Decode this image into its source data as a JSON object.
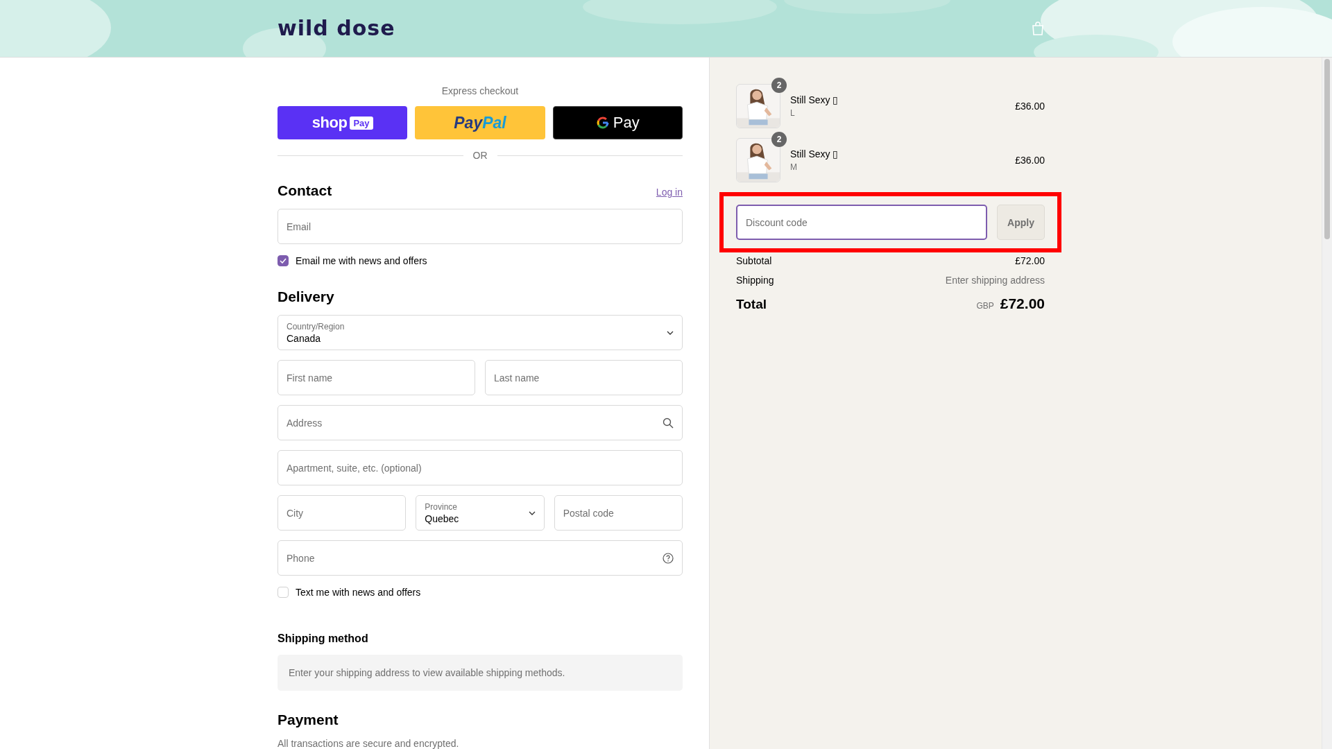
{
  "header": {
    "logo": "wild dose"
  },
  "express_checkout": {
    "title": "Express checkout",
    "buttons": [
      {
        "kind": "shop_pay",
        "text": "shop",
        "badge": "Pay"
      },
      {
        "kind": "paypal",
        "text": "Pay",
        "text2": "Pal"
      },
      {
        "kind": "google_pay",
        "text": "Pay"
      }
    ],
    "divider": "OR"
  },
  "contact": {
    "heading": "Contact",
    "link": "Log in",
    "email_placeholder": "Email",
    "newsletter": {
      "label": "Email me with news and offers",
      "checked": true
    }
  },
  "delivery": {
    "heading": "Delivery",
    "rows": [
      [
        {
          "kind": "select",
          "label": "Country/Region",
          "value": "Canada"
        }
      ],
      [
        {
          "kind": "input",
          "placeholder": "First name"
        },
        {
          "kind": "input",
          "placeholder": "Last name"
        }
      ],
      [
        {
          "kind": "search_input",
          "placeholder": "Address"
        }
      ],
      [
        {
          "kind": "input",
          "placeholder": "Apartment, suite, etc. (optional)"
        }
      ],
      [
        {
          "kind": "input",
          "placeholder": "City"
        },
        {
          "kind": "select",
          "label": "Province",
          "value": "Quebec"
        },
        {
          "kind": "input",
          "placeholder": "Postal code"
        }
      ],
      [
        {
          "kind": "help_input",
          "placeholder": "Phone"
        }
      ]
    ],
    "sms": {
      "label": "Text me with news and offers",
      "checked": false
    }
  },
  "shipping_method": {
    "heading": "Shipping method",
    "notice": "Enter your shipping address to view available shipping methods."
  },
  "payment": {
    "heading": "Payment",
    "note": "All transactions are secure and encrypted."
  },
  "summary": {
    "items": [
      {
        "quantity": "2",
        "title": "Still Sexy ▯",
        "variant": "L",
        "price": "£36.00"
      },
      {
        "quantity": "2",
        "title": "Still Sexy ▯",
        "variant": "M",
        "price": "£36.00"
      }
    ],
    "discount": {
      "placeholder": "Discount code",
      "button": "Apply",
      "highlighted": true
    },
    "lines": [
      {
        "label": "Subtotal",
        "value": "£72.00",
        "muted": false
      },
      {
        "label": "Shipping",
        "value": "Enter shipping address",
        "muted": true
      }
    ],
    "total": {
      "label": "Total",
      "currency": "GBP",
      "amount": "£72.00"
    }
  }
}
